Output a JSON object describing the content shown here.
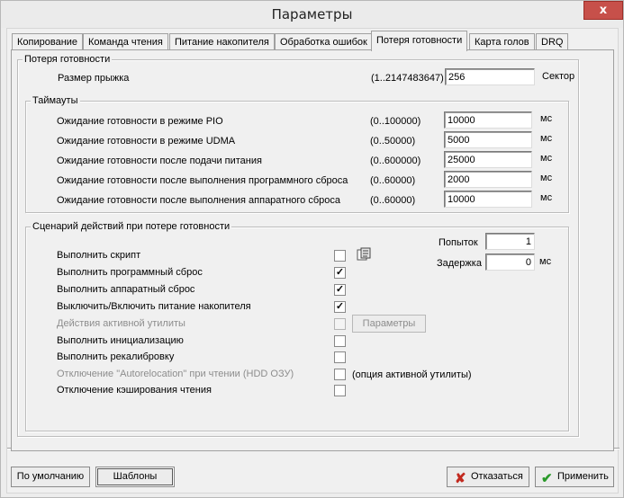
{
  "window": {
    "title": "Параметры",
    "close_glyph": "x"
  },
  "tabs": [
    {
      "label": "Копирование"
    },
    {
      "label": "Команда чтения"
    },
    {
      "label": "Питание накопителя"
    },
    {
      "label": "Обработка ошибок"
    },
    {
      "label": "Потеря готовности"
    },
    {
      "label": "Карта голов"
    },
    {
      "label": "DRQ"
    }
  ],
  "readiness": {
    "group_title": "Потеря готовности",
    "jump_label": "Размер прыжка",
    "jump_range": "(1..2147483647)",
    "jump_value": "256",
    "jump_unit": "Сектор"
  },
  "timeouts": {
    "group_title": "Таймауты",
    "rows": [
      {
        "label": "Ожидание готовности в режиме PIO",
        "range": "(0..100000)",
        "value": "10000",
        "unit": "мс"
      },
      {
        "label": "Ожидание готовности в режиме UDMA",
        "range": "(0..50000)",
        "value": "5000",
        "unit": "мс"
      },
      {
        "label": "Ожидание готовности после подачи питания",
        "range": "(0..600000)",
        "value": "25000",
        "unit": "мс"
      },
      {
        "label": "Ожидание готовности после выполнения программного сброса",
        "range": "(0..60000)",
        "value": "2000",
        "unit": "мс"
      },
      {
        "label": "Ожидание готовности после выполнения аппаратного сброса",
        "range": "(0..60000)",
        "value": "10000",
        "unit": "мс"
      }
    ]
  },
  "scenario": {
    "group_title": "Сценарий действий при потере готовности",
    "attempts_label": "Попыток",
    "attempts_value": "1",
    "delay_label": "Задержка",
    "delay_value": "0",
    "delay_unit": "мс",
    "params_button": "Параметры",
    "active_util_option": "(опция активной утилиты)",
    "actions": [
      {
        "label": "Выполнить скрипт",
        "checked": false,
        "disabled": false
      },
      {
        "label": "Выполнить программный сброс",
        "checked": true,
        "disabled": false
      },
      {
        "label": "Выполнить аппаратный сброс",
        "checked": true,
        "disabled": false
      },
      {
        "label": "Выключить/Включить питание накопителя",
        "checked": true,
        "disabled": false
      },
      {
        "label": "Действия активной утилиты",
        "checked": false,
        "disabled": true
      },
      {
        "label": "Выполнить инициализацию",
        "checked": false,
        "disabled": false
      },
      {
        "label": "Выполнить рекалибровку",
        "checked": false,
        "disabled": false
      },
      {
        "label": "Отключение \"Autorelocation\" при чтении (HDD ОЗУ)",
        "checked": false,
        "disabled": true
      },
      {
        "label": "Отключение кэширования чтения",
        "checked": false,
        "disabled": false
      }
    ]
  },
  "buttons": {
    "defaults": "По умолчанию",
    "templates": "Шаблоны",
    "cancel": "Отказаться",
    "apply": "Применить"
  },
  "colors": {
    "cancel_icon": "#c22a1f",
    "apply_icon": "#2a9a2a",
    "close_button": "#c7504a"
  },
  "icons": {
    "script_browse": "script-browse-icon",
    "cancel": "cross-icon",
    "apply": "checkmark-icon"
  }
}
